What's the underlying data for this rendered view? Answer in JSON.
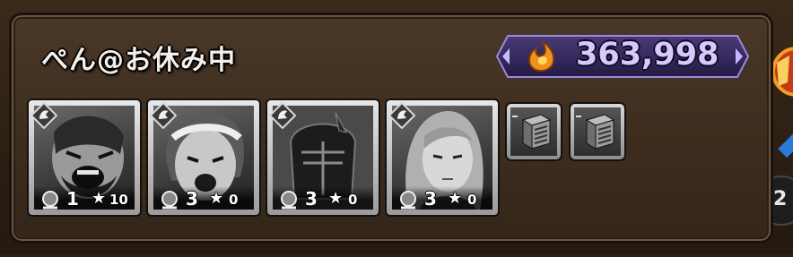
{
  "player": {
    "name": "ぺん@お休み中"
  },
  "currency": {
    "icon": "flame-coin-icon",
    "value": "363,998",
    "accent": "#7a66c8"
  },
  "cards": [
    {
      "name": "character-card-1",
      "portrait": "roaring-bearded-warrior",
      "level": "1",
      "stars": "10"
    },
    {
      "name": "character-card-2",
      "portrait": "shouting-girl-headband",
      "level": "3",
      "stars": "0"
    },
    {
      "name": "character-card-3",
      "portrait": "black-armored-knight",
      "level": "3",
      "stars": "0"
    },
    {
      "name": "character-card-4",
      "portrait": "long-haired-woman",
      "level": "3",
      "stars": "0"
    }
  ],
  "items": [
    {
      "name": "equipment-item-1",
      "icon": "cabinet-icon"
    },
    {
      "name": "equipment-item-2",
      "icon": "cabinet-icon"
    }
  ],
  "side": {
    "partial_text": "2"
  }
}
